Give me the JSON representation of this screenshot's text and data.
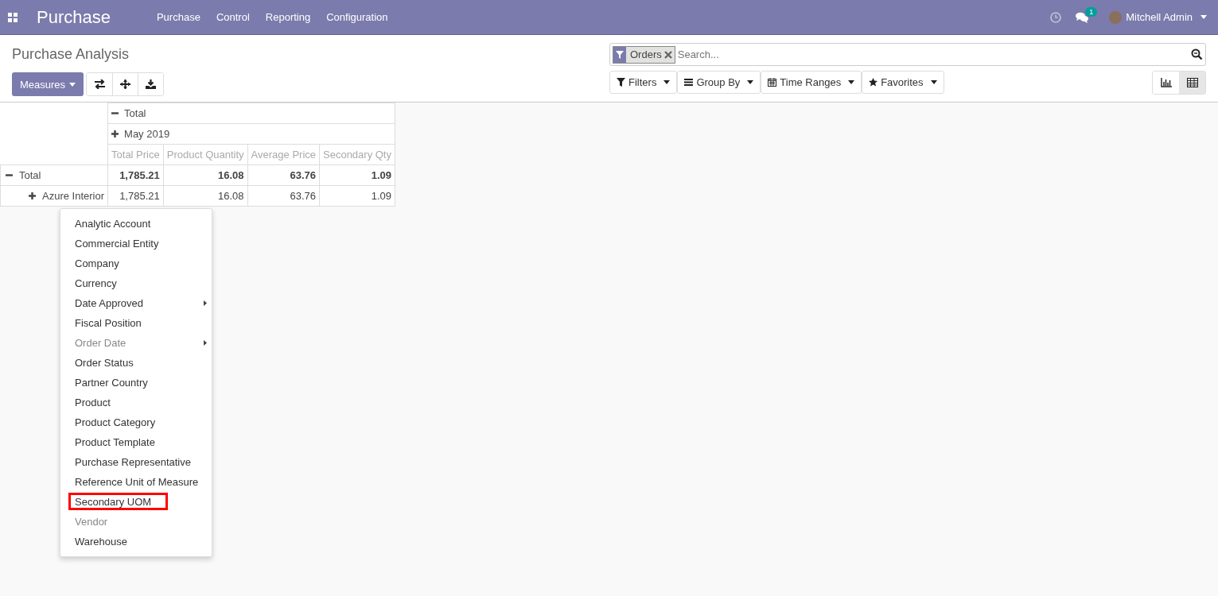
{
  "navbar": {
    "app_title": "Purchase",
    "menus": [
      "Purchase",
      "Control",
      "Reporting",
      "Configuration"
    ],
    "chat_badge": "1",
    "user_name": "Mitchell Admin"
  },
  "control_panel": {
    "title": "Purchase Analysis",
    "measures_button": "Measures",
    "search": {
      "facets": [
        {
          "label": "Orders"
        }
      ],
      "placeholder": "Search..."
    },
    "filter_buttons": [
      {
        "kind": "filter",
        "label": "Filters"
      },
      {
        "kind": "groupby",
        "label": "Group By"
      },
      {
        "kind": "timerange",
        "label": "Time Ranges"
      },
      {
        "kind": "favorite",
        "label": "Favorites"
      }
    ],
    "views": [
      {
        "kind": "graph",
        "selected": false
      },
      {
        "kind": "pivot",
        "selected": true
      }
    ]
  },
  "pivot": {
    "column_headers": [
      {
        "label": "Total",
        "expanded": true
      },
      {
        "label": "May 2019",
        "expanded": false
      }
    ],
    "measures": [
      "Total Price",
      "Product Quantity",
      "Average Price",
      "Secondary Qty"
    ],
    "rows": [
      {
        "label": "Total",
        "kind": "total",
        "expanded": true,
        "values": [
          "1,785.21",
          "16.08",
          "63.76",
          "1.09"
        ]
      },
      {
        "label": "Azure Interior",
        "kind": "group",
        "expanded": false,
        "values": [
          "1,785.21",
          "16.08",
          "63.76",
          "1.09"
        ]
      }
    ]
  },
  "groupby_menu": {
    "items": [
      {
        "label": "Analytic Account",
        "disabled": false,
        "has_submenu": false,
        "highlighted": false
      },
      {
        "label": "Commercial Entity",
        "disabled": false,
        "has_submenu": false,
        "highlighted": false
      },
      {
        "label": "Company",
        "disabled": false,
        "has_submenu": false,
        "highlighted": false
      },
      {
        "label": "Currency",
        "disabled": false,
        "has_submenu": false,
        "highlighted": false
      },
      {
        "label": "Date Approved",
        "disabled": false,
        "has_submenu": true,
        "highlighted": false
      },
      {
        "label": "Fiscal Position",
        "disabled": false,
        "has_submenu": false,
        "highlighted": false
      },
      {
        "label": "Order Date",
        "disabled": true,
        "has_submenu": true,
        "highlighted": false
      },
      {
        "label": "Order Status",
        "disabled": false,
        "has_submenu": false,
        "highlighted": false
      },
      {
        "label": "Partner Country",
        "disabled": false,
        "has_submenu": false,
        "highlighted": false
      },
      {
        "label": "Product",
        "disabled": false,
        "has_submenu": false,
        "highlighted": false
      },
      {
        "label": "Product Category",
        "disabled": false,
        "has_submenu": false,
        "highlighted": false
      },
      {
        "label": "Product Template",
        "disabled": false,
        "has_submenu": false,
        "highlighted": false
      },
      {
        "label": "Purchase Representative",
        "disabled": false,
        "has_submenu": false,
        "highlighted": false
      },
      {
        "label": "Reference Unit of Measure",
        "disabled": false,
        "has_submenu": false,
        "highlighted": false
      },
      {
        "label": "Secondary UOM",
        "disabled": false,
        "has_submenu": false,
        "highlighted": true
      },
      {
        "label": "Vendor",
        "disabled": true,
        "has_submenu": false,
        "highlighted": false
      },
      {
        "label": "Warehouse",
        "disabled": false,
        "has_submenu": false,
        "highlighted": false
      }
    ]
  }
}
